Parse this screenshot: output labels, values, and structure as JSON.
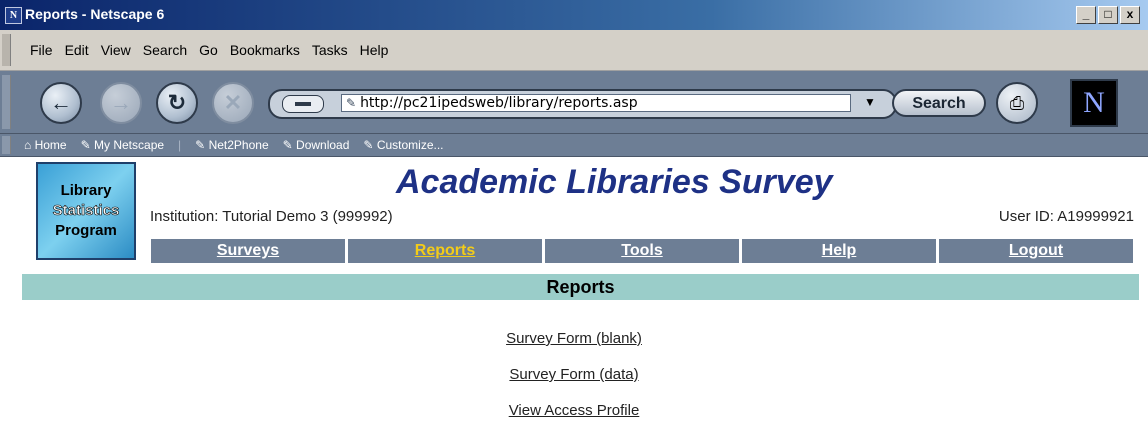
{
  "window": {
    "title": "Reports - Netscape 6",
    "app_icon": "N",
    "min": "_",
    "max": "□",
    "close": "x"
  },
  "menu": [
    "File",
    "Edit",
    "View",
    "Search",
    "Go",
    "Bookmarks",
    "Tasks",
    "Help"
  ],
  "toolbar": {
    "url": "http://pc21ipedsweb/library/reports.asp",
    "search_label": "Search",
    "logo": "N"
  },
  "personal": [
    "Home",
    "My Netscape",
    "Net2Phone",
    "Download",
    "Customize..."
  ],
  "page": {
    "logo_lines": [
      "Library",
      "Statistics",
      "Program"
    ],
    "site_title": "Academic Libraries Survey",
    "institution": "Institution: Tutorial Demo 3 (999992)",
    "user_id": "User ID: A19999921",
    "tabs": [
      "Surveys",
      "Reports",
      "Tools",
      "Help",
      "Logout"
    ],
    "selected_tab": "Reports",
    "section_title": "Reports",
    "links": [
      "Survey Form (blank)",
      "Survey Form (data)",
      "View Access Profile"
    ]
  },
  "colors": {
    "tab_bg": "#6d7e95",
    "tab_selected": "#f3cc18",
    "section_bar": "#9acdc9",
    "title_blue": "#1e3185"
  }
}
